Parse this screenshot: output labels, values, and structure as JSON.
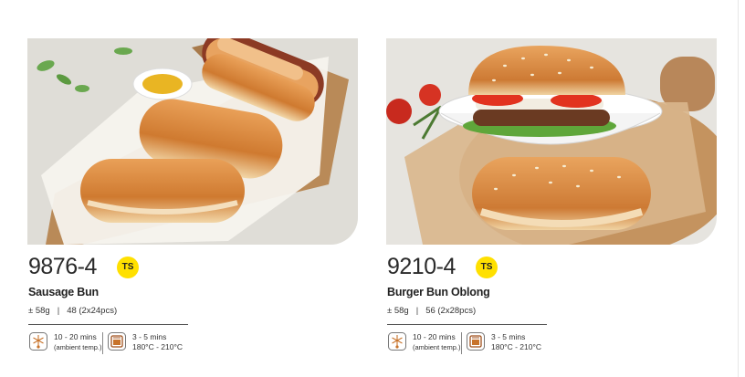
{
  "products": [
    {
      "code": "9876-4",
      "badge": "TS",
      "name": "Sausage Bun",
      "weight": "± 58g",
      "pack": "48 (2x24pcs)",
      "thaw_time": "10 - 20 mins",
      "thaw_note": "(ambient temp.)",
      "bake_time": "3 - 5 mins",
      "bake_temp": "180°C - 210°C",
      "icons": [
        "thaw-icon",
        "oven-icon"
      ],
      "photo": "sausage-buns-photo"
    },
    {
      "code": "9210-4",
      "badge": "TS",
      "name": "Burger Bun Oblong",
      "weight": "± 58g",
      "pack": "56 (2x28pcs)",
      "thaw_time": "10 - 20 mins",
      "thaw_note": "(ambient temp.)",
      "bake_time": "3 - 5 mins",
      "bake_temp": "180°C - 210°C",
      "icons": [
        "thaw-icon",
        "oven-icon"
      ],
      "photo": "burger-buns-photo"
    }
  ],
  "colors": {
    "badge": "#ffe000",
    "bun": "#d98a3c",
    "board": "#b98a58"
  }
}
